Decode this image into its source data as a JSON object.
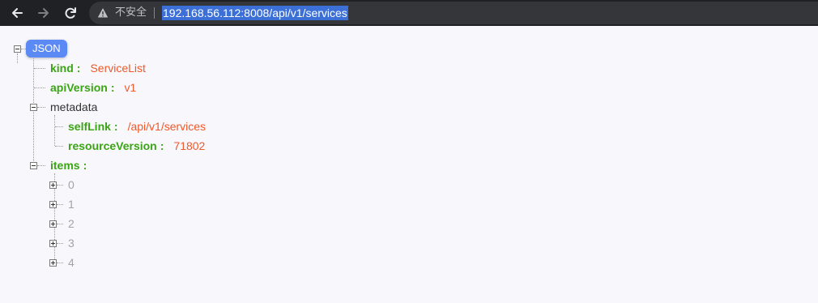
{
  "browser": {
    "security_label": "不安全",
    "url": "192.168.56.112:8008/api/v1/services",
    "icons": {
      "back": "arrow-left-icon",
      "forward": "arrow-right-icon",
      "reload": "reload-icon",
      "warning": "warning-triangle-icon"
    }
  },
  "json_viewer": {
    "root_label": "JSON",
    "separator": ":",
    "entries": [
      {
        "key": "kind",
        "value": "ServiceList"
      },
      {
        "key": "apiVersion",
        "value": "v1"
      },
      {
        "key": "metadata",
        "children": [
          {
            "key": "selfLink",
            "value": "/api/v1/services"
          },
          {
            "key": "resourceVersion",
            "value": "71802"
          }
        ]
      },
      {
        "key": "items",
        "collapsed_items": [
          "0",
          "1",
          "2",
          "3",
          "4"
        ]
      }
    ],
    "colors": {
      "key": "#3aa514",
      "value": "#f0582a",
      "index": "#a3a3a3",
      "badge": "#5b8af5"
    }
  }
}
